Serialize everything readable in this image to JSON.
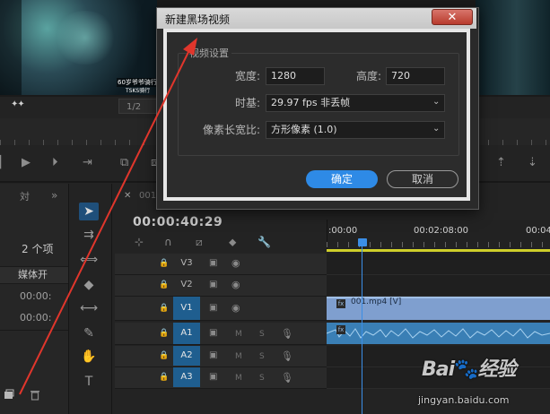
{
  "monitor": {
    "subtitle_line1": "60岁爷爷骑行",
    "subtitle_line2": "TSKS骑行",
    "zoom_value": "1/2"
  },
  "project_panel": {
    "tab_stub": "対",
    "overflow": "»",
    "item_count": "2 个项",
    "column_header": "媒体开",
    "rows": [
      "00:00:",
      "00:00:"
    ]
  },
  "timeline": {
    "tab_name": "001",
    "timecode": "00:00:40:29",
    "ruler_labels": [
      ":00:00",
      "00:02:08:00",
      "00:04"
    ],
    "tracks_video": [
      "V3",
      "V2",
      "V1"
    ],
    "tracks_audio": [
      "A1",
      "A2",
      "A3"
    ],
    "video_clip_name": "001.mp4 [V]",
    "track_mute": "M",
    "track_solo": "S"
  },
  "dialog": {
    "title": "新建黑场视频",
    "group_title": "视频设置",
    "width_label": "宽度:",
    "width_value": "1280",
    "height_label": "高度:",
    "height_value": "720",
    "timebase_label": "时基:",
    "timebase_value": "29.97 fps 非丢帧",
    "pixel_aspect_label": "像素长宽比:",
    "pixel_aspect_value": "方形像素 (1.0)",
    "ok_label": "确定",
    "cancel_label": "取消"
  },
  "watermark": {
    "logo_text_a": "Bai",
    "logo_text_b": "经验",
    "site": "jingyan.baidu.com"
  },
  "colors": {
    "accent_blue": "#2e8ae6",
    "annotation_red": "#e0362c",
    "work_area_yellow": "#cfcf2a"
  }
}
